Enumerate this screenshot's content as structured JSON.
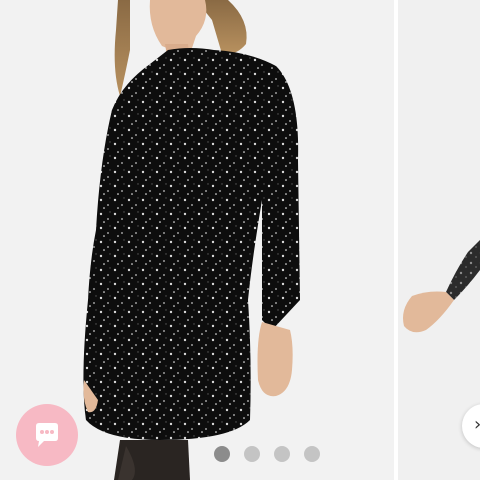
{
  "gallery": {
    "slides": [
      {
        "name": "front-view",
        "active": true
      },
      {
        "name": "side-view",
        "active": false
      }
    ],
    "pagination": {
      "total": 4,
      "current": 1
    }
  },
  "chat": {
    "icon": "chat-bubble-icon",
    "color": "#f7b9c4"
  },
  "next_arrow": {
    "icon": "chevron-right-icon",
    "glyph": "›"
  },
  "colors": {
    "background": "#f3f3f3",
    "dot_active": "#8c8c8c",
    "dot_inactive": "#c4c4c4"
  }
}
